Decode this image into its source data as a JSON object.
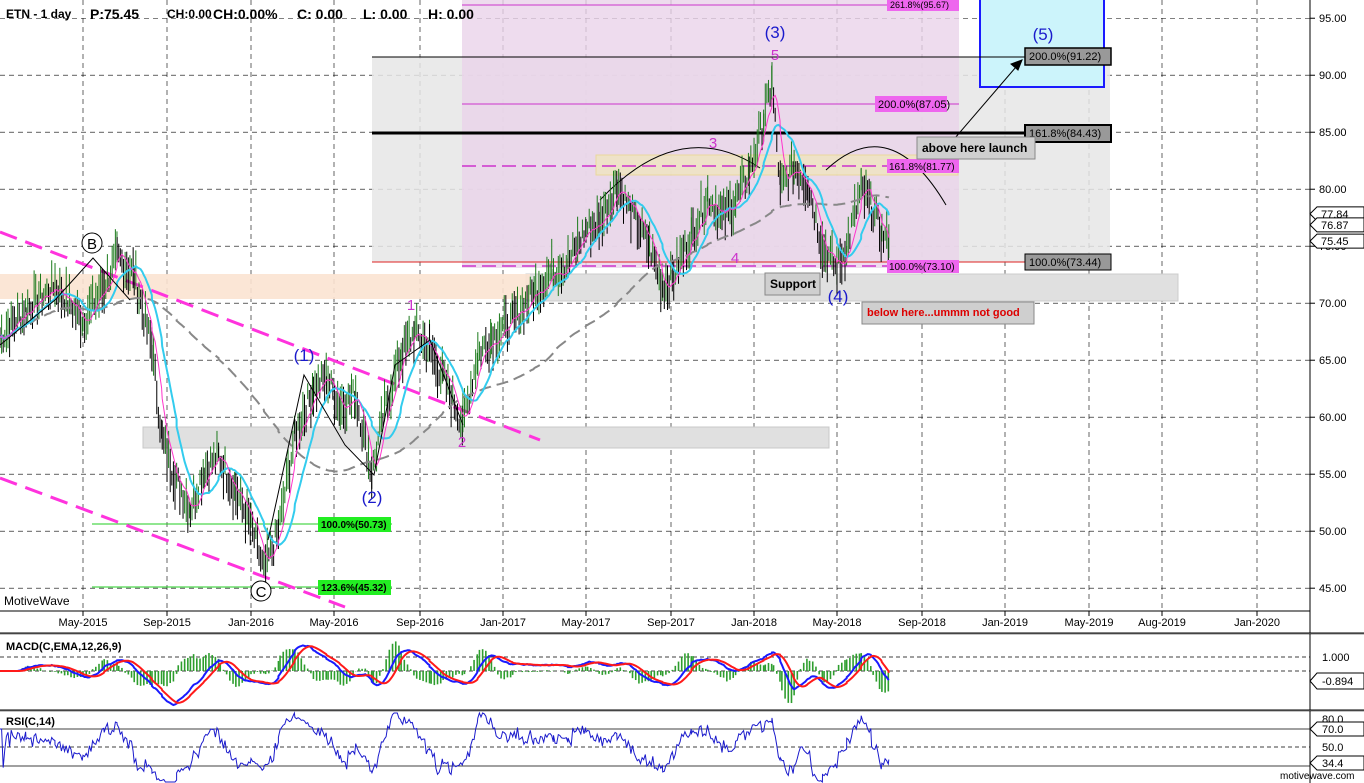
{
  "header": {
    "symbol": "ETN - 1 day",
    "price": "P:75.45",
    "change_abs": "CH:0.00",
    "change_pct": "CH:0.00%",
    "close": "C: 0.00",
    "low": "L: 0.00",
    "high": "H: 0.00"
  },
  "watermark_left": "MotiveWave",
  "watermark_right": "motivewave.com",
  "colors": {
    "price_bars": "#000000",
    "ma_fast": "#ff33cc",
    "ma_mid": "#33ccee",
    "ma_slow": "#888888",
    "wave_blue": "#1a1acc",
    "wave_magenta": "#cc33cc",
    "channel": "#ff33dd",
    "macd_line": "#1a1aff",
    "macd_signal": "#ff1a1a",
    "macd_hist": "#2e9e2e",
    "rsi_line": "#1a1acc"
  },
  "chart_data": [
    {
      "type": "line",
      "title": "ETN - 1 day",
      "x_ticks": [
        "May-2015",
        "Sep-2015",
        "Jan-2016",
        "May-2016",
        "Sep-2016",
        "Jan-2017",
        "May-2017",
        "Sep-2017",
        "Jan-2018",
        "May-2018",
        "Sep-2018",
        "Jan-2019",
        "May-2019",
        "Aug-2019",
        "Jan-2020"
      ],
      "y_ticks": [
        45.0,
        50.0,
        55.0,
        60.0,
        65.0,
        70.0,
        75.0,
        80.0,
        85.0,
        90.0,
        95.0
      ],
      "ylim": [
        43,
        96.6
      ],
      "grid": true,
      "price_tags": [
        "77.84",
        "76.87",
        "75.45"
      ],
      "series": [
        {
          "role": "price",
          "values": [
            [
              "2015-02-01",
              67.0
            ],
            [
              "2015-03-01",
              69.5
            ],
            [
              "2015-04-01",
              71.5
            ],
            [
              "2015-05-01",
              68.5
            ],
            [
              "2015-06-01",
              71.5
            ],
            [
              "2015-06-20",
              74.0
            ],
            [
              "2015-07-15",
              72.5
            ],
            [
              "2015-08-10",
              66.0
            ],
            [
              "2015-08-25",
              58.0
            ],
            [
              "2015-09-15",
              54.5
            ],
            [
              "2015-10-05",
              52.0
            ],
            [
              "2015-10-25",
              55.5
            ],
            [
              "2015-11-15",
              56.5
            ],
            [
              "2015-12-10",
              53.5
            ],
            [
              "2016-01-01",
              50.5
            ],
            [
              "2016-01-20",
              46.5
            ],
            [
              "2016-02-10",
              50.0
            ],
            [
              "2016-03-05",
              58.5
            ],
            [
              "2016-04-01",
              62.5
            ],
            [
              "2016-04-20",
              63.5
            ],
            [
              "2016-05-10",
              61.0
            ],
            [
              "2016-06-01",
              62.0
            ],
            [
              "2016-06-24",
              55.0
            ],
            [
              "2016-07-10",
              60.0
            ],
            [
              "2016-08-05",
              65.5
            ],
            [
              "2016-08-25",
              67.5
            ],
            [
              "2016-09-15",
              66.0
            ],
            [
              "2016-10-05",
              63.5
            ],
            [
              "2016-11-03",
              59.5
            ],
            [
              "2016-11-25",
              65.5
            ],
            [
              "2016-12-15",
              67.0
            ],
            [
              "2017-01-15",
              68.5
            ],
            [
              "2017-02-15",
              71.0
            ],
            [
              "2017-03-15",
              73.0
            ],
            [
              "2017-04-05",
              73.5
            ],
            [
              "2017-05-01",
              76.5
            ],
            [
              "2017-05-20",
              77.0
            ],
            [
              "2017-06-15",
              80.5
            ],
            [
              "2017-07-05",
              78.0
            ],
            [
              "2017-08-01",
              75.0
            ],
            [
              "2017-08-20",
              71.5
            ],
            [
              "2017-09-05",
              72.5
            ],
            [
              "2017-10-01",
              76.0
            ],
            [
              "2017-10-25",
              79.5
            ],
            [
              "2017-11-15",
              77.5
            ],
            [
              "2017-12-05",
              79.0
            ],
            [
              "2017-12-25",
              81.5
            ],
            [
              "2018-01-15",
              86.0
            ],
            [
              "2018-01-27",
              89.5
            ],
            [
              "2018-02-08",
              80.0
            ],
            [
              "2018-02-28",
              82.0
            ],
            [
              "2018-03-20",
              80.5
            ],
            [
              "2018-04-10",
              75.0
            ],
            [
              "2018-05-01",
              73.0
            ],
            [
              "2018-05-15",
              75.0
            ],
            [
              "2018-06-05",
              80.0
            ],
            [
              "2018-06-20",
              78.5
            ],
            [
              "2018-07-05",
              76.0
            ],
            [
              "2018-07-15",
              75.45
            ]
          ]
        }
      ]
    },
    {
      "type": "line",
      "title": "MACD(C,EMA,12,26,9)",
      "y_ticks": [
        "1.000"
      ],
      "value_tag": "-0.894"
    },
    {
      "type": "line",
      "title": "RSI(C,14)",
      "y_ticks": [
        "80.0",
        "70.0",
        "50.0"
      ],
      "value_tag": "34.4"
    }
  ],
  "fib_labels": {
    "f2618": "261.8%(95.67)",
    "f2000a": "200.0%(91.22)",
    "f2000b": "200.0%(87.05)",
    "f1618a": "161.8%(84.43)",
    "f1618b": "161.8%(81.77)",
    "f1000a": "100.0%(73.44)",
    "f1000b": "100.0%(73.10)",
    "f1000c": "100.0%(50.73)",
    "f1236": "123.6%(45.32)"
  },
  "notes": {
    "launch": "above here launch",
    "support": "Support",
    "not_good": "below here...ummm not good"
  },
  "wave_labels": {
    "B": "B",
    "C": "C",
    "w1": "(1)",
    "w2": "(2)",
    "w3": "(3)",
    "w4": "(4)",
    "w5": "(5)",
    "m1": "1",
    "m2": "2",
    "m3": "3",
    "m4": "4",
    "m5": "5"
  }
}
